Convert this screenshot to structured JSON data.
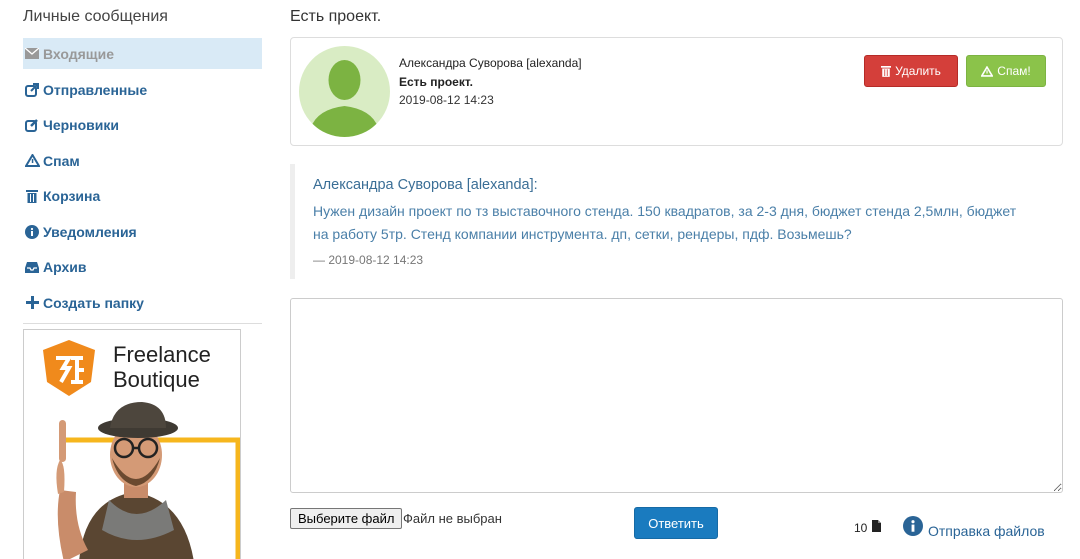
{
  "sidebar": {
    "title": "Личные сообщения",
    "items": [
      {
        "label": "Входящие",
        "icon": "envelope-icon"
      },
      {
        "label": "Отправленные",
        "icon": "share-icon"
      },
      {
        "label": "Черновики",
        "icon": "edit-icon"
      },
      {
        "label": "Спам",
        "icon": "warning-icon"
      },
      {
        "label": "Корзина",
        "icon": "trash-icon"
      },
      {
        "label": "Уведомления",
        "icon": "info-icon"
      },
      {
        "label": "Архив",
        "icon": "inbox-icon"
      },
      {
        "label": "Создать папку",
        "icon": "plus-icon"
      }
    ],
    "ad": {
      "brand_line1": "Freelance",
      "brand_line2": "Boutique",
      "accent": "#f08a1c"
    }
  },
  "main": {
    "title": "Есть проект.",
    "message": {
      "sender": "Александра Суворова [alexanda]",
      "subject": "Есть проект.",
      "date": "2019-08-12 14:23",
      "delete_label": "Удалить",
      "spam_label": "Спам!"
    },
    "quote": {
      "author": "Александра Суворова [alexanda]:",
      "text": "Нужен дизайн проект по тз выставочного стенда. 150 квадратов, за 2-3 дня, бюджет стенда 2,5млн, бюджет на работу 5тр. Стенд компании инструмента. дп, сетки, рендеры, пдф. Возьмешь?",
      "date": "— 2019-08-12 14:23"
    },
    "reply": {
      "placeholder": "",
      "file_button": "Выберите файл",
      "file_status": "Файл не выбран",
      "submit_label": "Ответить",
      "file_count": "10",
      "send_files_label": "Отправка файлов"
    }
  },
  "colors": {
    "link": "#2a6496",
    "active_bg": "#d9eaf6",
    "danger": "#d43f3a",
    "success": "#8bc34a",
    "primary": "#1a7bbf"
  }
}
